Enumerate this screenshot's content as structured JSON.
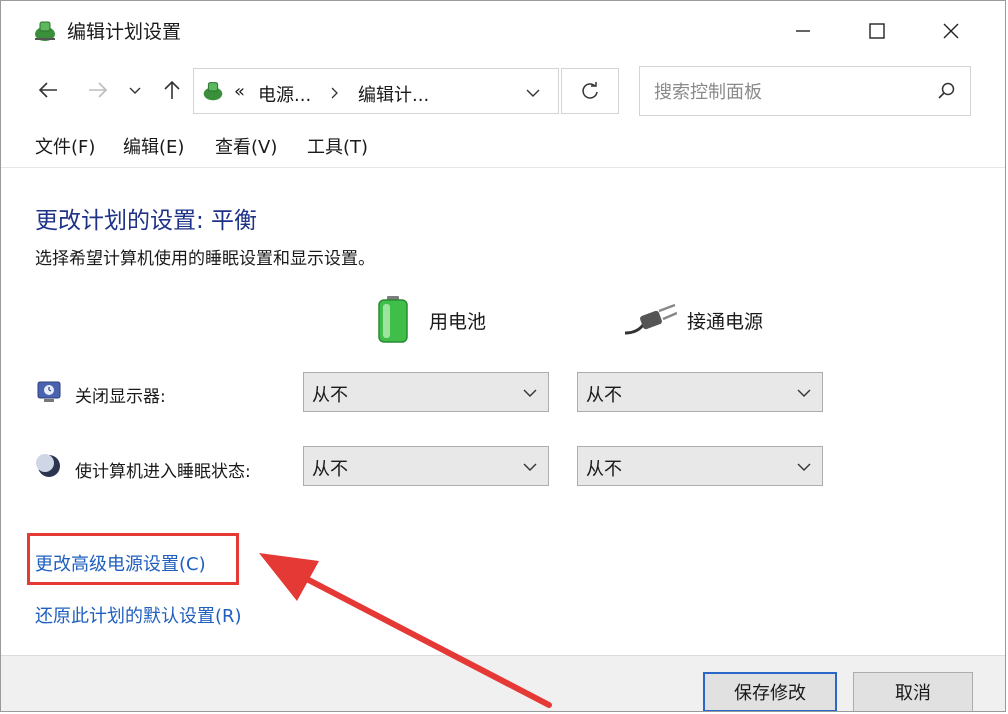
{
  "window": {
    "title": "编辑计划设置"
  },
  "breadcrumb": {
    "overflow": "«",
    "items": [
      "电源...",
      "编辑计..."
    ]
  },
  "search": {
    "placeholder": "搜索控制面板"
  },
  "menu": [
    "文件(F)",
    "编辑(E)",
    "查看(V)",
    "工具(T)"
  ],
  "content": {
    "title": "更改计划的设置: 平衡",
    "description": "选择希望计算机使用的睡眠设置和显示设置。",
    "columns": {
      "battery": "用电池",
      "plugged_in": "接通电源"
    },
    "rows": [
      {
        "label": "关闭显示器:",
        "battery": "从不",
        "plugged_in": "从不"
      },
      {
        "label": "使计算机进入睡眠状态:",
        "battery": "从不",
        "plugged_in": "从不"
      }
    ],
    "links": {
      "advanced": "更改高级电源设置(C)",
      "restore": "还原此计划的默认设置(R)"
    }
  },
  "buttons": {
    "save": "保存修改",
    "cancel": "取消"
  },
  "colors": {
    "title_blue": "#1e3287",
    "link_blue": "#1f5fbf",
    "annotation_red": "#e53935"
  }
}
